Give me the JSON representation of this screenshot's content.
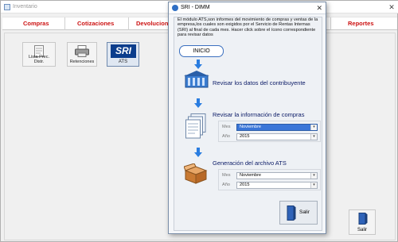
{
  "app": {
    "title": "Inventario",
    "menu": [
      "Compras",
      "Cotizaciones",
      "Devoluciones",
      "Reportes"
    ],
    "toolbar": [
      {
        "label": "Lista Prec. Distr.",
        "icon": "document-icon"
      },
      {
        "label": "Retenciones",
        "icon": "printer-icon"
      },
      {
        "label": "ATS",
        "icon": "sri-logo-icon",
        "logo_text": "SRI"
      }
    ],
    "exit_label": "Salir"
  },
  "dialog": {
    "title": "SRI - DIMM",
    "description": "El módulo ATS,son informes del movimiento de compras y ventas de la empresa,los cuales son exigidos por el Servicio de Rentas Internas (SRI) al final de cada mes. Hacer click sobre el ícono correspondiente para revisar datos",
    "start_label": "INICIO",
    "step1_label": "Revisar los datos del contribuyente",
    "step2_label": "Revisar la información de compras",
    "step3_label": "Generación del archivo ATS",
    "month_label": "Mes",
    "year_label": "Año",
    "purchases": {
      "month": "Noviembre",
      "year": "2015"
    },
    "ats": {
      "month": "Noviembre",
      "year": "2015"
    },
    "exit_label": "Salir"
  },
  "colors": {
    "menu_text": "#cc1111",
    "step_text": "#0a1a66",
    "accent": "#3a76d8",
    "sri_blue": "#0b3d8c"
  }
}
